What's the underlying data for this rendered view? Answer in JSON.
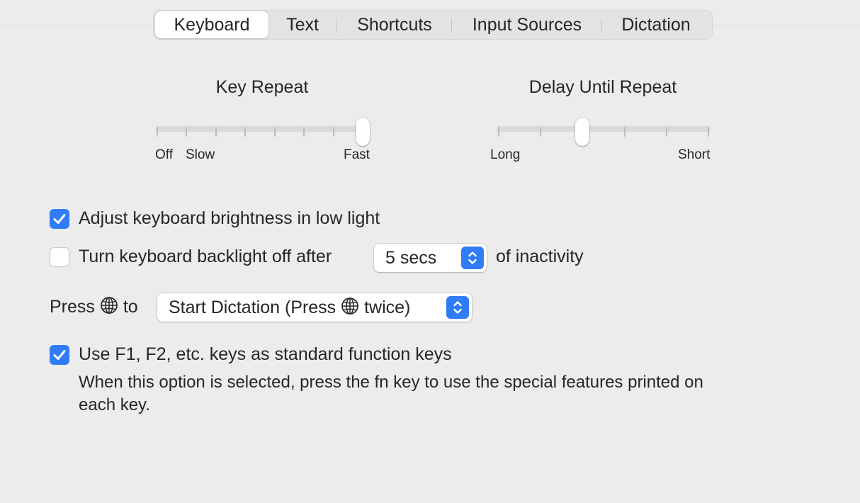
{
  "tabs": [
    {
      "label": "Keyboard",
      "selected": true
    },
    {
      "label": "Text",
      "selected": false
    },
    {
      "label": "Shortcuts",
      "selected": false
    },
    {
      "label": "Input Sources",
      "selected": false
    },
    {
      "label": "Dictation",
      "selected": false
    }
  ],
  "key_repeat": {
    "title": "Key Repeat",
    "label_off": "Off",
    "label_slow": "Slow",
    "label_fast": "Fast",
    "stops": 8,
    "value_stop": 8
  },
  "delay_until_repeat": {
    "title": "Delay Until Repeat",
    "label_long": "Long",
    "label_short": "Short",
    "stops": 6,
    "value_stop": 3
  },
  "adjust_brightness": {
    "label": "Adjust keyboard brightness in low light",
    "checked": true
  },
  "backlight_off": {
    "label": "Turn keyboard backlight off after",
    "checked": false,
    "popup_value": "5 secs",
    "suffix": "of inactivity"
  },
  "press_globe": {
    "prefix": "Press",
    "middle": "to",
    "popup_before": "Start Dictation (Press",
    "popup_after": "twice)"
  },
  "function_keys": {
    "label": "Use F1, F2, etc. keys as standard function keys",
    "checked": true,
    "description_line1": "When this option is selected, press the fn key to use the special features printed on",
    "description_line2": "each key."
  },
  "icons": {
    "checkmark": "checkmark-icon",
    "globe": "globe-icon",
    "stepper": "up-down-chevron-icon"
  },
  "colors": {
    "accent": "#2f7cf6",
    "background": "#ececec",
    "text": "#262626"
  }
}
